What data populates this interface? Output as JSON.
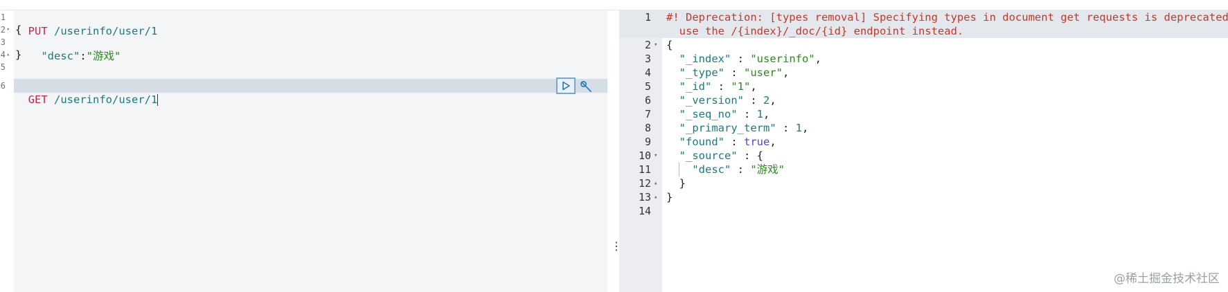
{
  "left_editor": {
    "line_numbers": [
      "1",
      "2",
      "3",
      "4",
      "5",
      "6"
    ],
    "fold_markers": [
      "",
      "▾",
      "",
      "▴",
      "",
      ""
    ],
    "lines": [
      {
        "method": "PUT",
        "path": " /userinfo/user/1"
      },
      {
        "text": "{"
      },
      {
        "key": "  \"desc\"",
        "sep": ":",
        "value": "\"游戏\""
      },
      {
        "text": "}"
      },
      {
        "text": ""
      },
      {
        "method": "GET",
        "path": " /userinfo/user/1"
      }
    ],
    "run_icon": "play-icon",
    "settings_icon": "wrench-icon"
  },
  "splitter": {
    "icon": "vertical-dots-icon",
    "glyph": "⋮"
  },
  "right_output": {
    "line_numbers": [
      "1",
      "",
      "2",
      "3",
      "4",
      "5",
      "6",
      "7",
      "8",
      "9",
      "10",
      "11",
      "12",
      "13",
      "14"
    ],
    "fold_markers": [
      "",
      "",
      "▾",
      "",
      "",
      "",
      "",
      "",
      "",
      "",
      "▾",
      "",
      "▴",
      "▴",
      ""
    ],
    "warning_line1": "#! Deprecation: [types removal] Specifying types in document get requests is deprecated,",
    "warning_line2": "  use the /{index}/_doc/{id} endpoint instead.",
    "open_brace": "{",
    "fields": [
      {
        "key": "\"_index\"",
        "value": "\"userinfo\"",
        "kind": "str"
      },
      {
        "key": "\"_type\"",
        "value": "\"user\"",
        "kind": "str"
      },
      {
        "key": "\"_id\"",
        "value": "\"1\"",
        "kind": "str"
      },
      {
        "key": "\"_version\"",
        "value": "2",
        "kind": "num"
      },
      {
        "key": "\"_seq_no\"",
        "value": "1",
        "kind": "num"
      },
      {
        "key": "\"_primary_term\"",
        "value": "1",
        "kind": "num"
      },
      {
        "key": "\"found\"",
        "value": "true",
        "kind": "bool"
      }
    ],
    "source_key": "\"_source\"",
    "source_desc_key": "\"desc\"",
    "source_desc_value": "\"游戏\"",
    "inner_close": "}",
    "outer_close": "}"
  },
  "watermark": "@稀土掘金技术社区"
}
